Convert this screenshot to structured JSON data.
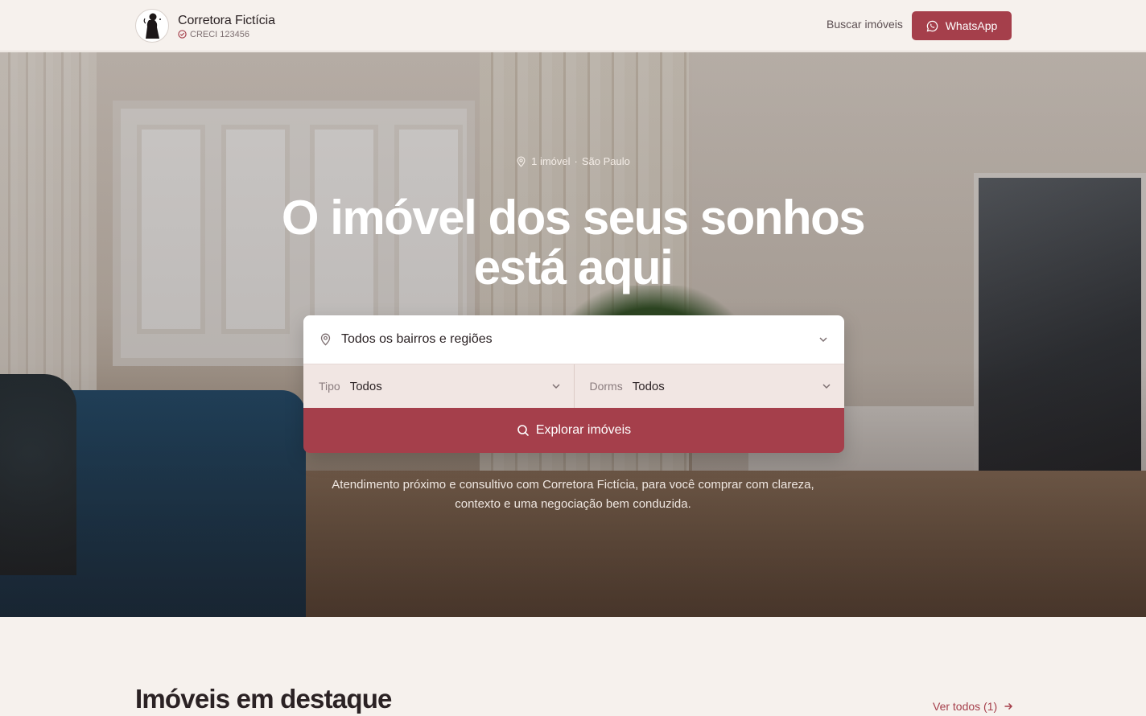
{
  "header": {
    "brand_name": "Corretora Fictícia",
    "creci": "CRECI 123456",
    "nav_search": "Buscar imóveis",
    "whatsapp_label": "WhatsApp"
  },
  "hero": {
    "meta_count": "1 imóvel",
    "meta_separator": "·",
    "meta_city": "São Paulo",
    "title_line1": "O imóvel dos seus sonhos",
    "title_line2": "está aqui",
    "description": "Atendimento próximo e consultivo com Corretora Fictícia, para você comprar com clareza, contexto e uma negociação bem conduzida."
  },
  "search": {
    "region_value": "Todos os bairros e regiões",
    "type_caption": "Tipo",
    "type_value": "Todos",
    "rooms_caption": "Dorms",
    "rooms_value": "Todos",
    "explore_label": "Explorar imóveis"
  },
  "featured": {
    "title": "Imóveis em destaque",
    "see_all": "Ver todos (1)"
  },
  "colors": {
    "accent": "#a53f4b",
    "background": "#f6f1ed",
    "filters_bg": "#f1e6e3"
  },
  "icons": {
    "logo": "woman-silhouette-logo",
    "creci": "check-circle-icon",
    "whatsapp": "whatsapp-icon",
    "location": "map-pin-icon",
    "chevron": "chevron-down-icon",
    "search": "search-icon",
    "arrow": "arrow-right-icon"
  }
}
